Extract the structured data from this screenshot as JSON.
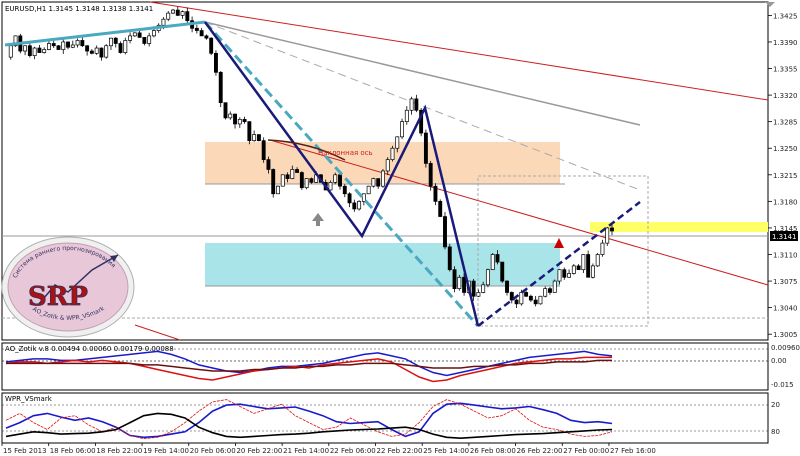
{
  "window": {
    "symbol_header": "EURUSD,H1  1.3145 1.3148 1.3138 1.3141"
  },
  "current_price": "1.3141",
  "annotation_label": "Наклонная ось",
  "logo": {
    "text": "SRP",
    "ring_top": "Система раннего прогнозирования",
    "ring_bottom": "AO_Zotik & WPR_VSmark"
  },
  "indicators": {
    "ao": {
      "header": "AO_Zotik v.8 0.00494 0.00060 0.00179 0.00088",
      "axis_labels": [
        "0.00960",
        "0.00",
        "-0.015"
      ]
    },
    "wpr": {
      "header": "WPR_VSmark",
      "axis_labels": [
        "20",
        "80"
      ]
    }
  },
  "colors": {
    "bull_candle": "#000000",
    "bear_candle": "#000000",
    "channel_red": "#cc2020",
    "pattern_navy": "#1a1a7a",
    "trend_teal": "#4aa8c0",
    "zone_orange": "#fbd9b8",
    "zone_cyan": "#a8e4e8",
    "zone_yellow": "#ffff66",
    "ao_blue": "#1a1acc",
    "ao_red": "#dd1111",
    "ao_dark": "#6a1010",
    "wpr_blue": "#1a1acc",
    "wpr_red": "#dd1111",
    "wpr_black": "#000000"
  },
  "chart_data": [
    {
      "type": "candlestick",
      "title": "EURUSD,H1  1.3145 1.3148 1.3138 1.3141",
      "y_tick_labels": [
        "1.3425",
        "1.3390",
        "1.3355",
        "1.3320",
        "1.3285",
        "1.3250",
        "1.3215",
        "1.3180",
        "1.3145",
        "1.3110",
        "1.3075",
        "1.3040",
        "1.3005"
      ],
      "ylim": [
        1.3,
        1.344
      ],
      "x_tick_labels": [
        "15 Feb 2013",
        "18 Feb 06:00",
        "18 Feb 22:00",
        "19 Feb 14:00",
        "20 Feb 06:00",
        "20 Feb 22:00",
        "21 Feb 14:00",
        "22 Feb 06:00",
        "22 Feb 22:00",
        "25 Feb 14:00",
        "26 Feb 08:00",
        "26 Feb 22:00",
        "27 Feb 00:00",
        "27 Feb 16:00"
      ],
      "path": [
        1.337,
        1.3385,
        1.3398,
        1.3378,
        1.3385,
        1.3372,
        1.3382,
        1.3376,
        1.338,
        1.3388,
        1.3385,
        1.338,
        1.339,
        1.3383,
        1.3386,
        1.3392,
        1.3385,
        1.3378,
        1.3375,
        1.3382,
        1.337,
        1.3385,
        1.3395,
        1.3388,
        1.3376,
        1.3392,
        1.3398,
        1.3402,
        1.3396,
        1.3388,
        1.3398,
        1.3405,
        1.3412,
        1.342,
        1.3428,
        1.3432,
        1.3425,
        1.343,
        1.3418,
        1.3408,
        1.3405,
        1.3398,
        1.3395,
        1.3375,
        1.335,
        1.331,
        1.329,
        1.3295,
        1.3282,
        1.3288,
        1.3285,
        1.326,
        1.3268,
        1.326,
        1.3235,
        1.3222,
        1.319,
        1.32,
        1.3215,
        1.321,
        1.3222,
        1.3218,
        1.3198,
        1.321,
        1.3205,
        1.3215,
        1.3205,
        1.3195,
        1.3205,
        1.3215,
        1.32,
        1.319,
        1.3178,
        1.317,
        1.318,
        1.319,
        1.32,
        1.321,
        1.32,
        1.322,
        1.3235,
        1.325,
        1.3265,
        1.3285,
        1.33,
        1.3315,
        1.33,
        1.327,
        1.323,
        1.32,
        1.318,
        1.316,
        1.312,
        1.309,
        1.3065,
        1.308,
        1.306,
        1.3075,
        1.3055,
        1.306,
        1.307,
        1.309,
        1.311,
        1.31,
        1.3075,
        1.306,
        1.305,
        1.3045,
        1.306,
        1.3055,
        1.305,
        1.3045,
        1.3055,
        1.3065,
        1.306,
        1.3075,
        1.309,
        1.308,
        1.3085,
        1.3095,
        1.309,
        1.311,
        1.308,
        1.3095,
        1.311,
        1.3125,
        1.3145,
        1.3141
      ]
    },
    {
      "type": "line",
      "title": "AO_Zotik v.8 0.00494 0.00060 0.00179 0.00088",
      "ylim": [
        -0.015,
        0.0096
      ],
      "series": [
        {
          "name": "blue",
          "values": [
            0.001,
            0.002,
            0.003,
            0.003,
            0.002,
            0.002,
            0.003,
            0.004,
            0.005,
            0.006,
            0.007,
            0.008,
            0.006,
            0.003,
            -0.001,
            -0.003,
            -0.005,
            -0.006,
            -0.005,
            -0.003,
            -0.002,
            -0.002,
            -0.001,
            0.0,
            0.002,
            0.004,
            0.006,
            0.007,
            0.005,
            0.003,
            -0.002,
            -0.006,
            -0.008,
            -0.006,
            -0.004,
            -0.002,
            0.0,
            0.002,
            0.004,
            0.005,
            0.006,
            0.007,
            0.008,
            0.006,
            0.005
          ]
        },
        {
          "name": "red",
          "values": [
            0.0,
            0.001,
            0.001,
            0.0,
            0.001,
            0.002,
            0.001,
            0.002,
            0.001,
            0.0,
            -0.002,
            -0.004,
            -0.006,
            -0.008,
            -0.01,
            -0.011,
            -0.009,
            -0.007,
            -0.005,
            -0.004,
            -0.003,
            -0.002,
            -0.003,
            -0.001,
            0.0,
            0.001,
            0.002,
            0.003,
            0.001,
            -0.004,
            -0.009,
            -0.012,
            -0.011,
            -0.008,
            -0.006,
            -0.004,
            -0.002,
            0.0,
            0.001,
            0.002,
            0.003,
            0.003,
            0.004,
            0.004,
            0.004
          ]
        },
        {
          "name": "dark",
          "values": [
            0.0,
            0.0,
            0.0,
            0.0,
            0.0,
            0.0,
            0.0,
            0.0,
            0.0,
            0.0,
            -0.001,
            -0.001,
            -0.002,
            -0.003,
            -0.004,
            -0.005,
            -0.005,
            -0.005,
            -0.004,
            -0.004,
            -0.003,
            -0.003,
            -0.002,
            -0.002,
            -0.001,
            -0.001,
            0.0,
            0.0,
            0.0,
            -0.001,
            -0.002,
            -0.003,
            -0.003,
            -0.003,
            -0.002,
            -0.002,
            -0.001,
            -0.001,
            0.0,
            0.0,
            0.001,
            0.001,
            0.001,
            0.002,
            0.002
          ]
        }
      ]
    },
    {
      "type": "line",
      "title": "WPR_VSmark",
      "ylim": [
        0,
        100
      ],
      "series": [
        {
          "name": "blue",
          "values": [
            72,
            60,
            45,
            40,
            48,
            55,
            50,
            58,
            70,
            88,
            92,
            90,
            85,
            80,
            60,
            35,
            22,
            20,
            25,
            30,
            28,
            26,
            35,
            45,
            58,
            62,
            60,
            58,
            75,
            90,
            80,
            40,
            20,
            18,
            22,
            26,
            30,
            28,
            25,
            32,
            40,
            55,
            60,
            58,
            62
          ]
        },
        {
          "name": "red",
          "values": [
            55,
            40,
            60,
            75,
            50,
            45,
            65,
            80,
            70,
            88,
            95,
            92,
            80,
            60,
            35,
            15,
            10,
            25,
            40,
            30,
            20,
            45,
            60,
            75,
            70,
            50,
            65,
            80,
            90,
            85,
            60,
            25,
            10,
            20,
            35,
            50,
            45,
            30,
            55,
            70,
            75,
            85,
            90,
            88,
            80
          ]
        },
        {
          "name": "black",
          "values": [
            90,
            85,
            80,
            82,
            85,
            84,
            83,
            80,
            75,
            60,
            45,
            40,
            42,
            50,
            70,
            82,
            90,
            92,
            90,
            88,
            86,
            85,
            83,
            80,
            78,
            76,
            75,
            74,
            72,
            70,
            75,
            85,
            92,
            94,
            92,
            90,
            88,
            86,
            85,
            84,
            82,
            80,
            78,
            76,
            75
          ]
        }
      ]
    }
  ]
}
